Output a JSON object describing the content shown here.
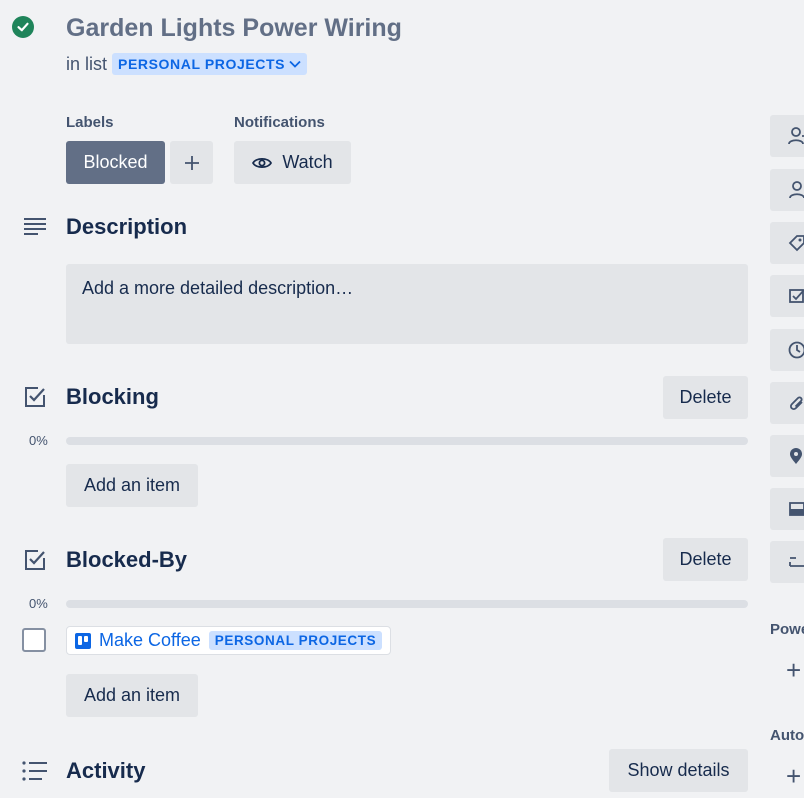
{
  "card": {
    "title": "Garden Lights Power Wiring",
    "in_list_prefix": "in list",
    "list_name": "PERSONAL PROJECTS"
  },
  "labels": {
    "heading": "Labels",
    "items": [
      "Blocked"
    ],
    "add": "+"
  },
  "notifications": {
    "heading": "Notifications",
    "watch_label": "Watch"
  },
  "description": {
    "heading": "Description",
    "placeholder": "Add a more detailed description…"
  },
  "checklists": [
    {
      "title": "Blocking",
      "delete_label": "Delete",
      "progress_text": "0%",
      "progress": 0,
      "add_item_label": "Add an item",
      "items": []
    },
    {
      "title": "Blocked-By",
      "delete_label": "Delete",
      "progress_text": "0%",
      "progress": 0,
      "add_item_label": "Add an item",
      "items": [
        {
          "checked": false,
          "card_title": "Make Coffee",
          "list_badge": "PERSONAL PROJECTS"
        }
      ]
    }
  ],
  "activity": {
    "heading": "Activity",
    "show_details_label": "Show details"
  },
  "sidebar": {
    "power_ups_heading": "Powe",
    "automation_heading": "Auto",
    "plus": "+"
  },
  "colors": {
    "accent": "#0c66e4",
    "badge_bg": "#cce0ff",
    "label_blocked": "#626f86",
    "complete_green": "#1f845a"
  }
}
